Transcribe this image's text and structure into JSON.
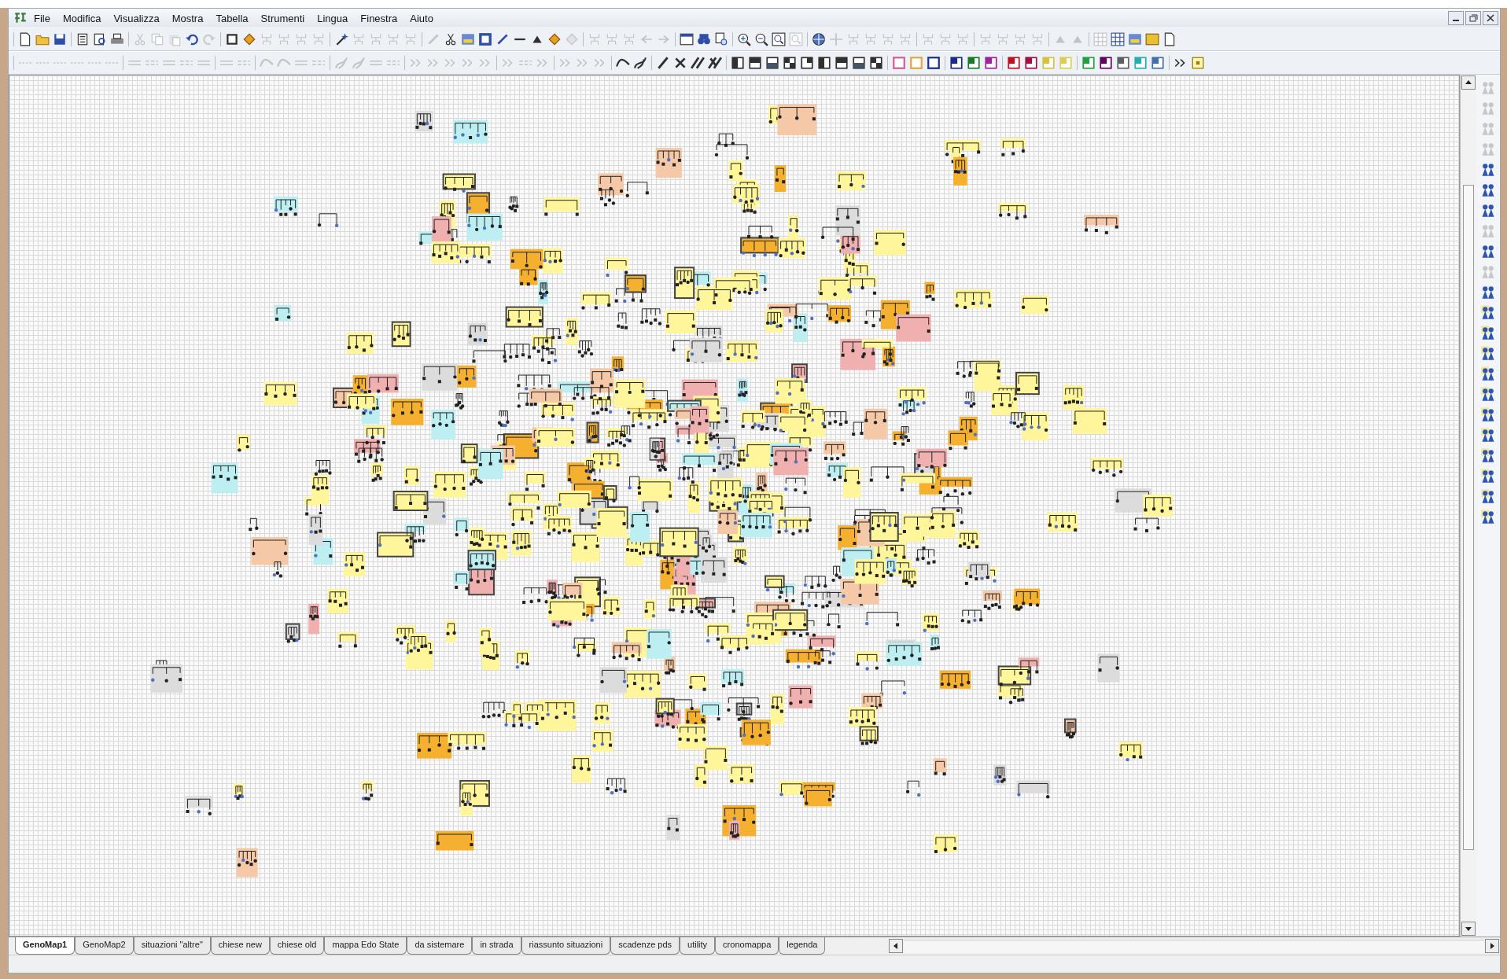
{
  "menu": [
    "File",
    "Modifica",
    "Visualizza",
    "Mostra",
    "Tabella",
    "Strumenti",
    "Lingua",
    "Finestra",
    "Aiuto"
  ],
  "toolbars": [
    {
      "groups": [
        [
          {
            "kind": "doc",
            "disabled": false
          },
          {
            "kind": "folder",
            "disabled": false
          },
          {
            "kind": "disk",
            "disabled": false
          }
        ],
        [
          {
            "kind": "page",
            "disabled": false
          },
          {
            "kind": "preview",
            "disabled": false
          },
          {
            "kind": "printer",
            "disabled": false
          }
        ],
        [
          {
            "kind": "cut",
            "disabled": true
          },
          {
            "kind": "copy",
            "disabled": true
          },
          {
            "kind": "paste",
            "disabled": true
          },
          {
            "kind": "undo",
            "disabled": false
          },
          {
            "kind": "redo",
            "disabled": true
          }
        ],
        [
          {
            "kind": "shape",
            "disabled": false
          },
          {
            "kind": "fill",
            "disabled": false
          },
          {
            "kind": "tree",
            "disabled": true
          },
          {
            "kind": "tree",
            "disabled": true
          },
          {
            "kind": "tree",
            "disabled": true
          },
          {
            "kind": "tree",
            "disabled": true
          }
        ],
        [
          {
            "kind": "wand",
            "disabled": false
          },
          {
            "kind": "tree",
            "disabled": true
          },
          {
            "kind": "tree",
            "disabled": true
          },
          {
            "kind": "tree",
            "disabled": true
          },
          {
            "kind": "tree",
            "disabled": true
          }
        ],
        [
          {
            "kind": "pen",
            "disabled": true
          },
          {
            "kind": "cut",
            "disabled": false
          },
          {
            "kind": "image",
            "disabled": false
          },
          {
            "kind": "textbox",
            "disabled": false
          },
          {
            "kind": "pen",
            "disabled": false
          },
          {
            "kind": "dash",
            "disabled": false
          },
          {
            "kind": "triangle",
            "disabled": false
          },
          {
            "kind": "fill",
            "disabled": false
          },
          {
            "kind": "fill",
            "disabled": true
          }
        ],
        [
          {
            "kind": "tree",
            "disabled": true
          },
          {
            "kind": "tree",
            "disabled": true
          },
          {
            "kind": "tree",
            "disabled": true
          },
          {
            "kind": "left",
            "disabled": true
          },
          {
            "kind": "right",
            "disabled": true
          }
        ],
        [
          {
            "kind": "window",
            "disabled": false
          },
          {
            "kind": "binoculars",
            "disabled": false
          },
          {
            "kind": "findpage",
            "disabled": false
          }
        ],
        [
          {
            "kind": "zoomin",
            "disabled": false
          },
          {
            "kind": "zoomout",
            "disabled": false
          },
          {
            "kind": "zoomfit",
            "disabled": false
          },
          {
            "kind": "zoomfit",
            "disabled": true
          }
        ],
        [
          {
            "kind": "globe",
            "disabled": false
          },
          {
            "kind": "move",
            "disabled": true
          },
          {
            "kind": "tree",
            "disabled": true
          },
          {
            "kind": "tree",
            "disabled": true
          },
          {
            "kind": "tree",
            "disabled": true
          },
          {
            "kind": "tree",
            "disabled": true
          }
        ],
        [
          {
            "kind": "tree",
            "disabled": true
          },
          {
            "kind": "tree",
            "disabled": true
          },
          {
            "kind": "tree",
            "disabled": true
          }
        ],
        [
          {
            "kind": "tree",
            "disabled": true
          },
          {
            "kind": "tree",
            "disabled": true
          },
          {
            "kind": "tree",
            "disabled": true
          },
          {
            "kind": "tree",
            "disabled": true
          }
        ],
        [
          {
            "kind": "triangle",
            "disabled": true
          },
          {
            "kind": "triangle",
            "disabled": true
          }
        ],
        [
          {
            "kind": "grid",
            "disabled": true
          },
          {
            "kind": "grid",
            "disabled": false
          },
          {
            "kind": "image",
            "disabled": false
          },
          {
            "kind": "notes",
            "disabled": false
          },
          {
            "kind": "doc",
            "disabled": false
          }
        ]
      ]
    },
    {
      "groups": [
        [
          {
            "kind": "dots",
            "disabled": true
          },
          {
            "kind": "dots",
            "disabled": true
          },
          {
            "kind": "dots",
            "disabled": true
          },
          {
            "kind": "dots",
            "disabled": true
          },
          {
            "kind": "dots",
            "disabled": true
          },
          {
            "kind": "dots",
            "disabled": true
          }
        ],
        [
          {
            "kind": "lines",
            "disabled": true
          },
          {
            "kind": "lines",
            "disabled": true
          },
          {
            "kind": "lines",
            "disabled": true
          },
          {
            "kind": "lines",
            "disabled": true
          },
          {
            "kind": "lines",
            "disabled": true
          }
        ],
        [
          {
            "kind": "lines",
            "disabled": true
          },
          {
            "kind": "lines",
            "disabled": true
          }
        ],
        [
          {
            "kind": "curve",
            "disabled": true
          },
          {
            "kind": "curve",
            "disabled": true
          },
          {
            "kind": "lines",
            "disabled": true
          },
          {
            "kind": "lines",
            "disabled": true
          }
        ],
        [
          {
            "kind": "squiggle",
            "disabled": true
          },
          {
            "kind": "squiggle",
            "disabled": true
          },
          {
            "kind": "lines",
            "disabled": true
          },
          {
            "kind": "lines",
            "disabled": true
          }
        ],
        [
          {
            "kind": "arrow",
            "disabled": true
          },
          {
            "kind": "arrow",
            "disabled": true
          },
          {
            "kind": "arrow",
            "disabled": true
          },
          {
            "kind": "arrow",
            "disabled": true
          },
          {
            "kind": "arrow",
            "disabled": true
          }
        ],
        [
          {
            "kind": "arrow",
            "disabled": true
          },
          {
            "kind": "lines",
            "disabled": true
          },
          {
            "kind": "arrow",
            "disabled": true
          }
        ],
        [
          {
            "kind": "arrow",
            "disabled": true
          },
          {
            "kind": "arrow",
            "disabled": true
          },
          {
            "kind": "arrow",
            "disabled": true
          }
        ],
        [
          {
            "kind": "curve",
            "disabled": false
          },
          {
            "kind": "squiggle",
            "disabled": false
          }
        ],
        [
          {
            "kind": "slash",
            "disabled": false
          },
          {
            "kind": "cross",
            "disabled": false
          },
          {
            "kind": "dslash",
            "disabled": false
          },
          {
            "kind": "dcross",
            "disabled": false
          }
        ],
        [
          {
            "kind": "half",
            "disabled": false
          },
          {
            "kind": "half",
            "disabled": false
          },
          {
            "kind": "half",
            "disabled": false
          },
          {
            "kind": "half",
            "disabled": false
          },
          {
            "kind": "half",
            "disabled": false
          },
          {
            "kind": "half",
            "disabled": false
          },
          {
            "kind": "half",
            "disabled": false
          },
          {
            "kind": "half",
            "disabled": false
          },
          {
            "kind": "half",
            "disabled": false
          }
        ],
        [
          {
            "kind": "swatch",
            "disabled": false,
            "color": "#d0609a"
          },
          {
            "kind": "swatch",
            "disabled": false,
            "color": "#e0a848"
          },
          {
            "kind": "swatch",
            "disabled": false,
            "color": "#20308a"
          }
        ],
        [
          {
            "kind": "split",
            "disabled": false,
            "color": "#1a2a8a"
          },
          {
            "kind": "split",
            "disabled": false,
            "color": "#1a7a2a"
          },
          {
            "kind": "split",
            "disabled": false,
            "color": "#a020a0"
          }
        ],
        [
          {
            "kind": "split",
            "disabled": false,
            "color": "#c01020"
          },
          {
            "kind": "split",
            "disabled": false,
            "color": "#a01040"
          },
          {
            "kind": "split",
            "disabled": false,
            "color": "#d8c040"
          },
          {
            "kind": "split",
            "disabled": false,
            "color": "#d8d050"
          }
        ],
        [
          {
            "kind": "split",
            "disabled": false,
            "color": "#20a040"
          },
          {
            "kind": "split",
            "disabled": false,
            "color": "#600060"
          },
          {
            "kind": "split",
            "disabled": false,
            "color": "#606060"
          },
          {
            "kind": "split",
            "disabled": false,
            "color": "#20b0b0"
          },
          {
            "kind": "split",
            "disabled": false,
            "color": "#4070b0"
          }
        ],
        [
          {
            "kind": "arrow",
            "disabled": false
          },
          {
            "kind": "target",
            "disabled": false
          }
        ]
      ]
    }
  ],
  "side_toolbar": [
    {
      "kind": "pair",
      "disabled": true
    },
    {
      "kind": "pair",
      "disabled": true
    },
    {
      "kind": "pair",
      "disabled": true
    },
    {
      "kind": "pair",
      "disabled": true
    },
    {
      "kind": "pair",
      "disabled": false
    },
    {
      "kind": "pair",
      "disabled": false
    },
    {
      "kind": "pair",
      "disabled": false
    },
    {
      "kind": "pair",
      "disabled": true
    },
    {
      "kind": "pair",
      "disabled": false
    },
    {
      "kind": "pair",
      "disabled": true
    },
    {
      "kind": "pair",
      "disabled": false
    },
    {
      "kind": "pair-note",
      "disabled": false
    },
    {
      "kind": "pair-note",
      "disabled": false
    },
    {
      "kind": "pair-note",
      "disabled": false
    },
    {
      "kind": "pair-note",
      "disabled": false
    },
    {
      "kind": "pair-note",
      "disabled": false
    },
    {
      "kind": "pair-note",
      "disabled": false
    },
    {
      "kind": "pair-note",
      "disabled": false
    },
    {
      "kind": "pair-note",
      "disabled": false
    },
    {
      "kind": "pair-note",
      "disabled": false
    },
    {
      "kind": "pair-note",
      "disabled": false
    },
    {
      "kind": "pair-note",
      "disabled": false
    }
  ],
  "tabs": [
    {
      "label": "GenoMap1",
      "selected": true
    },
    {
      "label": "GenoMap2",
      "selected": false
    },
    {
      "label": "situazioni \"altre\"",
      "selected": false
    },
    {
      "label": "chiese new",
      "selected": false
    },
    {
      "label": "chiese old",
      "selected": false
    },
    {
      "label": "mappa Edo State",
      "selected": false
    },
    {
      "label": "da sistemare",
      "selected": false
    },
    {
      "label": "in strada",
      "selected": false
    },
    {
      "label": "riassunto situazioni",
      "selected": false
    },
    {
      "label": "scadenze pds",
      "selected": false
    },
    {
      "label": "utility",
      "selected": false
    },
    {
      "label": "cronomappa",
      "selected": false
    },
    {
      "label": "legenda",
      "selected": false
    }
  ]
}
